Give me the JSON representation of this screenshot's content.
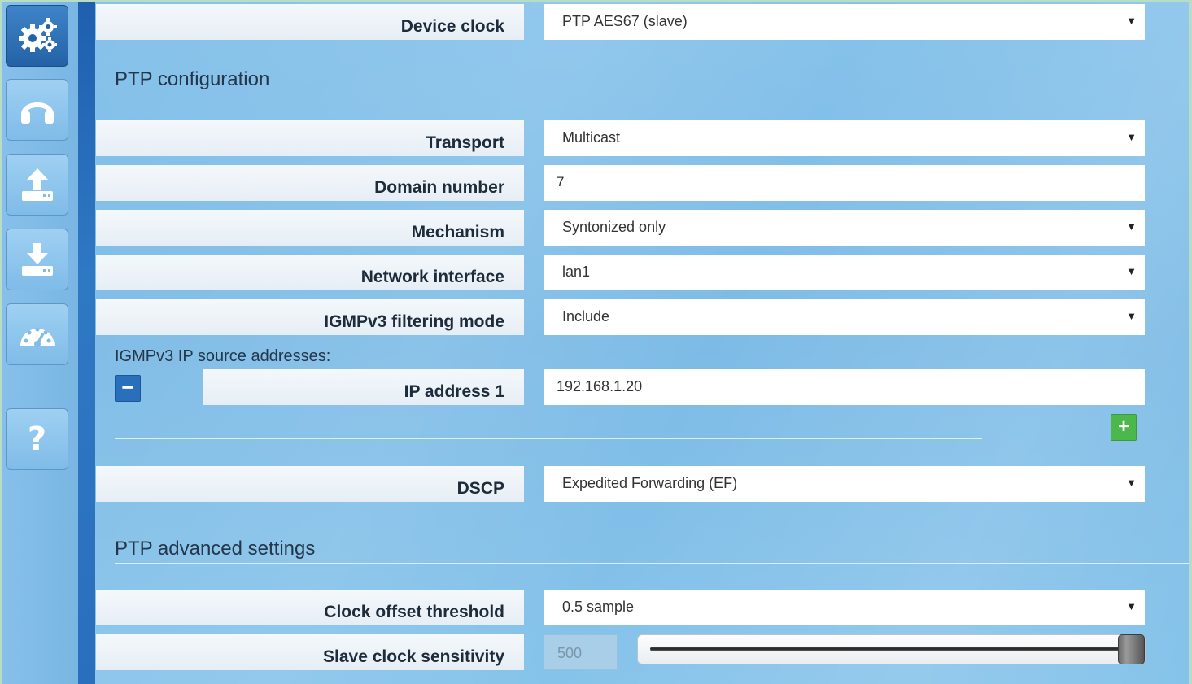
{
  "sidebar": {
    "buttons": [
      {
        "name": "settings-gears-icon"
      },
      {
        "name": "headphones-icon"
      },
      {
        "name": "upload-icon"
      },
      {
        "name": "download-icon"
      },
      {
        "name": "dashboard-gauge-icon"
      },
      {
        "name": "help-icon",
        "glyph": "?"
      }
    ]
  },
  "device_clock": {
    "label": "Device clock",
    "value": "PTP AES67 (slave)"
  },
  "ptp_config": {
    "heading": "PTP configuration",
    "transport": {
      "label": "Transport",
      "value": "Multicast"
    },
    "domain_number": {
      "label": "Domain number",
      "value": "7"
    },
    "mechanism": {
      "label": "Mechanism",
      "value": "Syntonized only"
    },
    "network_interface": {
      "label": "Network interface",
      "value": "lan1"
    },
    "igmp_mode": {
      "label": "IGMPv3 filtering mode",
      "value": "Include"
    },
    "igmp_sources": {
      "label": "IGMPv3 IP source addresses:",
      "entries": [
        {
          "label": "IP address 1",
          "value": "192.168.1.20",
          "remove_glyph": "−"
        }
      ],
      "add_glyph": "+"
    },
    "dscp": {
      "label": "DSCP",
      "value": "Expedited Forwarding (EF)"
    }
  },
  "ptp_advanced": {
    "heading": "PTP advanced settings",
    "clock_offset_threshold": {
      "label": "Clock offset threshold",
      "value": "0.5 sample"
    },
    "slave_clock_sensitivity": {
      "label": "Slave clock sensitivity",
      "value": "500",
      "slider_level": 1.0
    }
  },
  "select_arrow": "▼",
  "colors": {
    "background": "#7dbbe6",
    "add_button": "#4cb84c",
    "remove_button": "#2a6fbc",
    "active_sidebar": "#2462a6"
  }
}
